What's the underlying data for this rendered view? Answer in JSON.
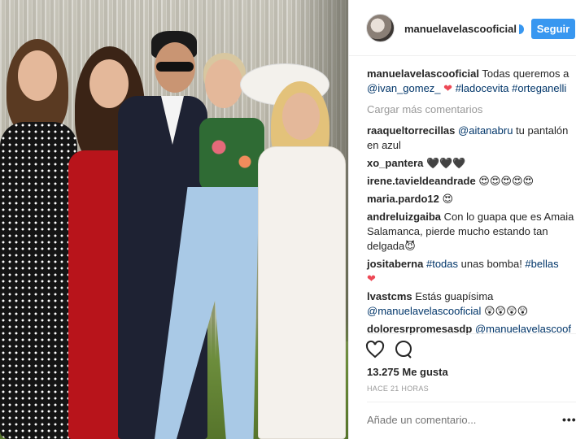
{
  "post": {
    "username": "manuelavelascooficial",
    "follow_label": "Seguir",
    "caption": {
      "user": "manuelavelascooficial",
      "text_a": " Todas queremos a ",
      "mention": "@ivan_gomez_",
      "heart": "❤",
      "tag1": "#ladocevita",
      "tag2": "#orteganelli"
    },
    "load_more": "Cargar más comentarios",
    "comments": [
      {
        "user": "raaqueltorrecillas",
        "mention": "@aitanabru",
        "text": " tu pantalón en azul"
      },
      {
        "user": "xo_pantera",
        "text": "🖤🖤🖤"
      },
      {
        "user": "irene.tavieldeandrade",
        "text": "😍😍😍😍😍"
      },
      {
        "user": "maria.pardo12",
        "text": "😍"
      },
      {
        "user": "andreluizgaiba",
        "text": " Con lo guapa que es Amaia Salamanca, pierde mucho estando tan delgada😈"
      },
      {
        "user": "josita­berna",
        "tag1": "#todas",
        "text_mid": " unas bomba! ",
        "tag2": "#bellas",
        "heart": "❤"
      },
      {
        "user": "lvastcms",
        "text": " Estás guapísima",
        "mention": "@manuelavelascooficial",
        "text_end": " 😲😲😲😲"
      },
      {
        "user": "doloresrpromesasdp",
        "mention": "@manuelavelascoof"
      }
    ],
    "likes": "13.275 Me gusta",
    "timestamp": "HACE 21 HORAS",
    "add_comment_placeholder": "Añade un comentario...",
    "more_label": "•••",
    "icons": {
      "like": "heart-icon",
      "comment": "comment-icon",
      "more": "more-icon"
    },
    "colors": {
      "accent": "#3897f0",
      "link": "#003569",
      "heart": "#ed4956",
      "muted": "#999999"
    }
  }
}
